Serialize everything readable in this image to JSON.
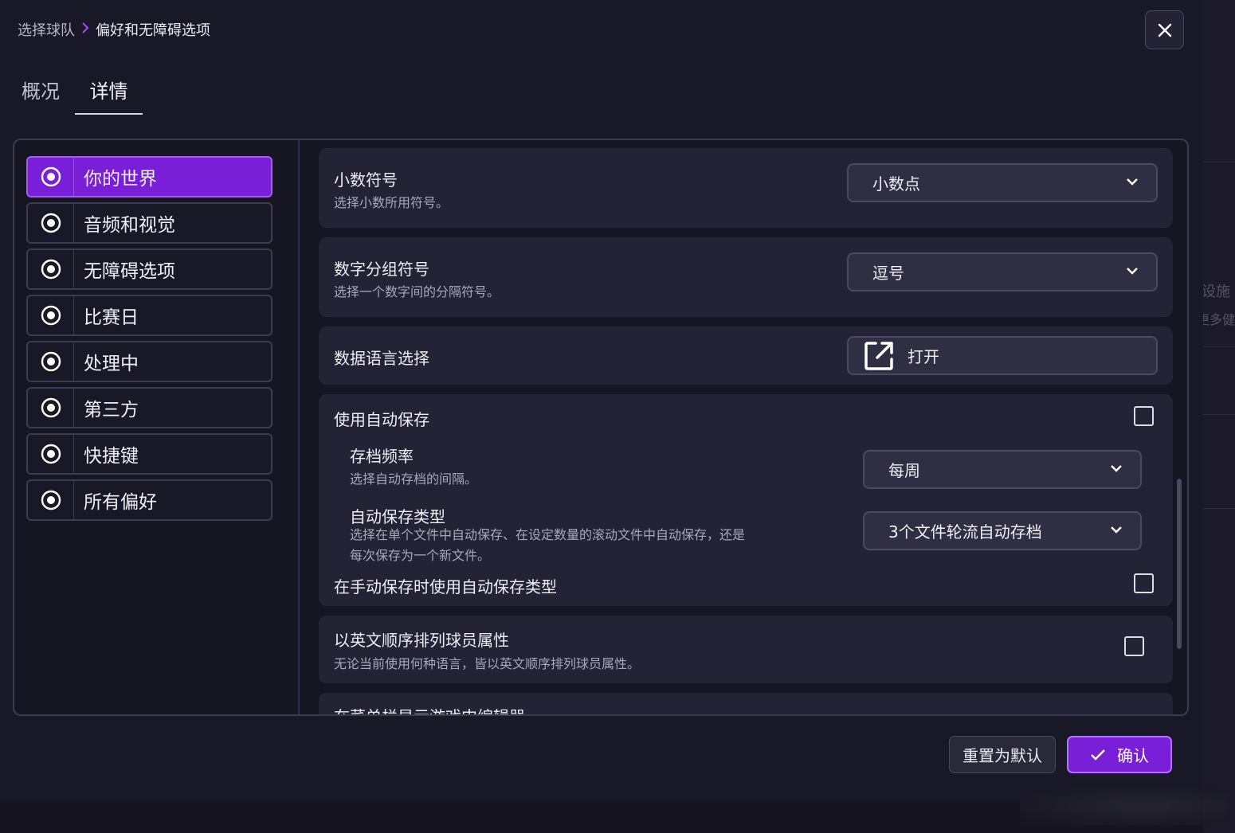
{
  "breadcrumb": {
    "parent": "选择球队",
    "current": "偏好和无障碍选项"
  },
  "tabs": [
    {
      "label": "概况"
    },
    {
      "label": "详情"
    }
  ],
  "sidebar": {
    "items": [
      {
        "label": "你的世界",
        "active": true
      },
      {
        "label": "音频和视觉"
      },
      {
        "label": "无障碍选项"
      },
      {
        "label": "比赛日"
      },
      {
        "label": "处理中"
      },
      {
        "label": "第三方"
      },
      {
        "label": "快捷键"
      },
      {
        "label": "所有偏好"
      }
    ]
  },
  "settings": {
    "decimal": {
      "title": "小数符号",
      "desc": "选择小数所用符号。",
      "value": "小数点"
    },
    "grouping": {
      "title": "数字分组符号",
      "desc": "选择一个数字间的分隔符号。",
      "value": "逗号"
    },
    "data_language": {
      "title": "数据语言选择",
      "button": "打开"
    },
    "autosave": {
      "title": "使用自动保存",
      "checked": false,
      "frequency": {
        "title": "存档频率",
        "desc": "选择自动存档的间隔。",
        "value": "每周"
      },
      "type": {
        "title": "自动保存类型",
        "desc_line1": "选择在单个文件中自动保存、在设定数量的滚动文件中自动保存，还是",
        "desc_line2": "每次保存为一个新文件。",
        "value": "3个文件轮流自动存档"
      },
      "manual": {
        "title": "在手动保存时使用自动保存类型",
        "checked": false
      }
    },
    "english_order": {
      "title": "以英文顺序排列球员属性",
      "desc": "无论当前使用何种语言，皆以英文顺序排列球员属性。",
      "checked": false
    },
    "editor_menu": {
      "title": "在菜单栏显示游戏中编辑器"
    }
  },
  "footer": {
    "reset_label": "重置为默认",
    "confirm_label": "确认"
  },
  "background": {
    "text1": "设施",
    "text2": "更多健"
  },
  "colors": {
    "accent": "#7a1fd8",
    "accent_border": "#a35bf5",
    "card": "#242335",
    "panel": "#161522"
  }
}
